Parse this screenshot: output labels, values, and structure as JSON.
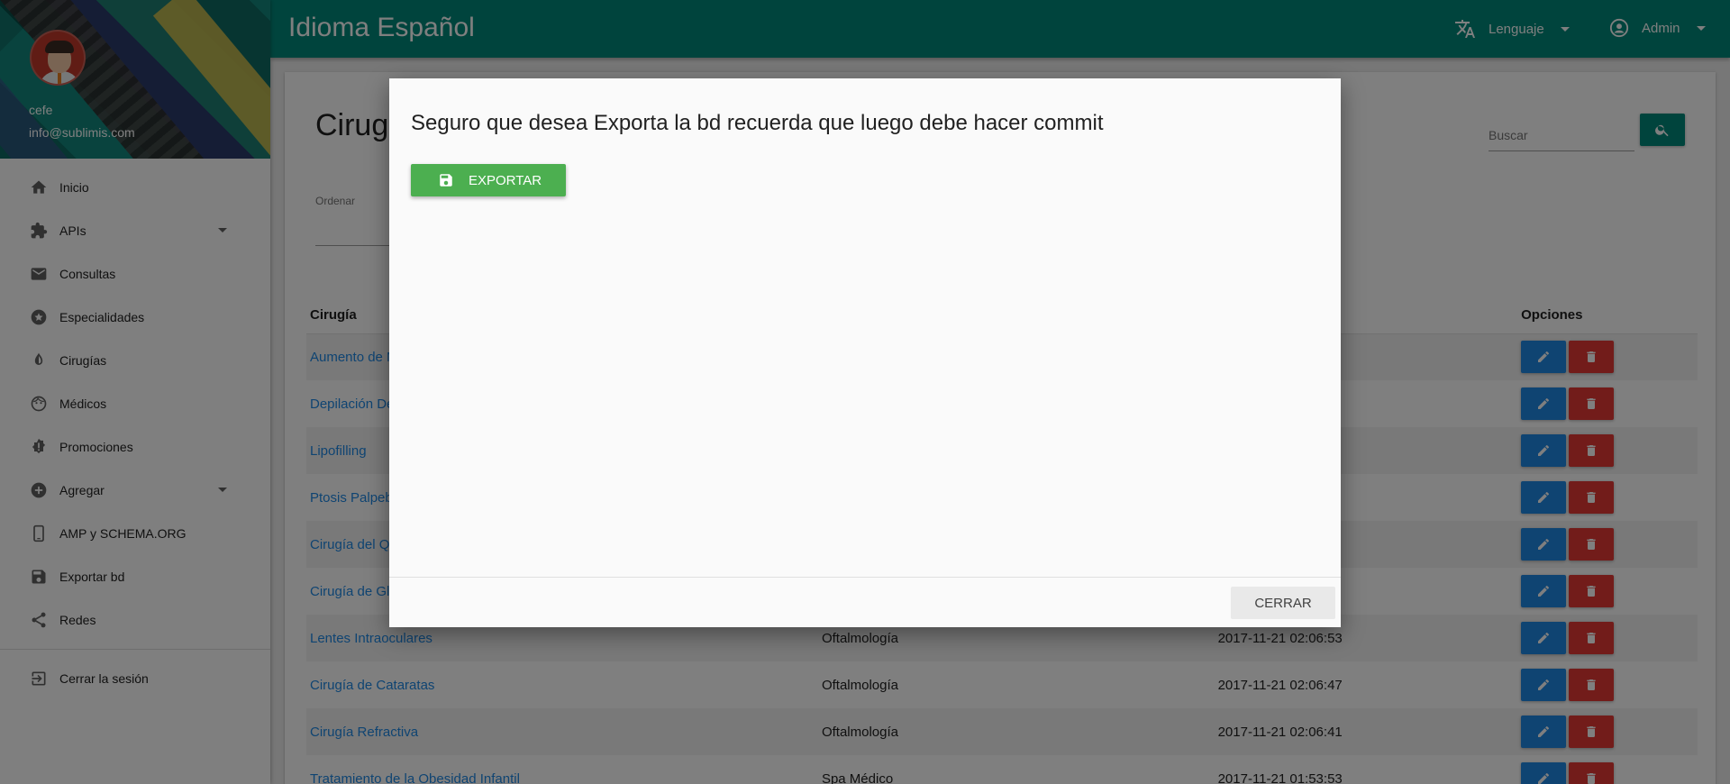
{
  "sidebar": {
    "user_name": "cefe",
    "user_email": "info@sublimis.com",
    "items": [
      {
        "label": "Inicio",
        "icon": "home-icon"
      },
      {
        "label": "APIs",
        "icon": "puzzle-icon",
        "expandable": true
      },
      {
        "label": "Consultas",
        "icon": "mail-icon"
      },
      {
        "label": "Especialidades",
        "icon": "star-circle-icon"
      },
      {
        "label": "Cirugías",
        "icon": "contrast-icon"
      },
      {
        "label": "Médicos",
        "icon": "face-icon"
      },
      {
        "label": "Promociones",
        "icon": "badge-alert-icon"
      },
      {
        "label": "Agregar",
        "icon": "add-circle-icon",
        "expandable": true
      },
      {
        "label": "AMP y SCHEMA.ORG",
        "icon": "phone-icon"
      },
      {
        "label": "Exportar bd",
        "icon": "save-icon"
      },
      {
        "label": "Redes",
        "icon": "share-icon"
      }
    ],
    "logout_label": "Cerrar la sesión"
  },
  "topbar": {
    "title": "Idioma Español",
    "language_label": "Lenguaje",
    "user_label": "Admin"
  },
  "main": {
    "page_title": "Cirugías",
    "order_label": "Ordenar",
    "search_placeholder": "Buscar",
    "table": {
      "headers": [
        "Cirugía",
        "",
        "",
        "Opciones"
      ],
      "rows": [
        {
          "name": "Aumento de M",
          "category": "",
          "date": ""
        },
        {
          "name": "Depilación De",
          "category": "",
          "date": ""
        },
        {
          "name": "Lipofilling",
          "category": "",
          "date": ""
        },
        {
          "name": "Ptosis Palpeb",
          "category": "",
          "date": ""
        },
        {
          "name": "Cirugía del Qu",
          "category": "",
          "date": ""
        },
        {
          "name": "Cirugía de Gla",
          "category": "",
          "date": ""
        },
        {
          "name": "Lentes Intraoculares",
          "category": "Oftalmología",
          "date": "2017-11-21 02:06:53"
        },
        {
          "name": "Cirugía de Cataratas",
          "category": "Oftalmología",
          "date": "2017-11-21 02:06:47"
        },
        {
          "name": "Cirugía Refractiva",
          "category": "Oftalmología",
          "date": "2017-11-21 02:06:41"
        },
        {
          "name": "Tratamiento de la Obesidad Infantil",
          "category": "Spa Médico",
          "date": "2017-11-21 01:53:53"
        }
      ]
    }
  },
  "modal": {
    "title": "Seguro que desea Exporta la bd recuerda que luego debe hacer commit",
    "export_label": "EXPORTAR",
    "close_label": "CERRAR"
  },
  "colors": {
    "primary": "#00897b",
    "export_green": "#4caf50",
    "edit_blue": "#1e88e5",
    "delete_red": "#e53935"
  }
}
